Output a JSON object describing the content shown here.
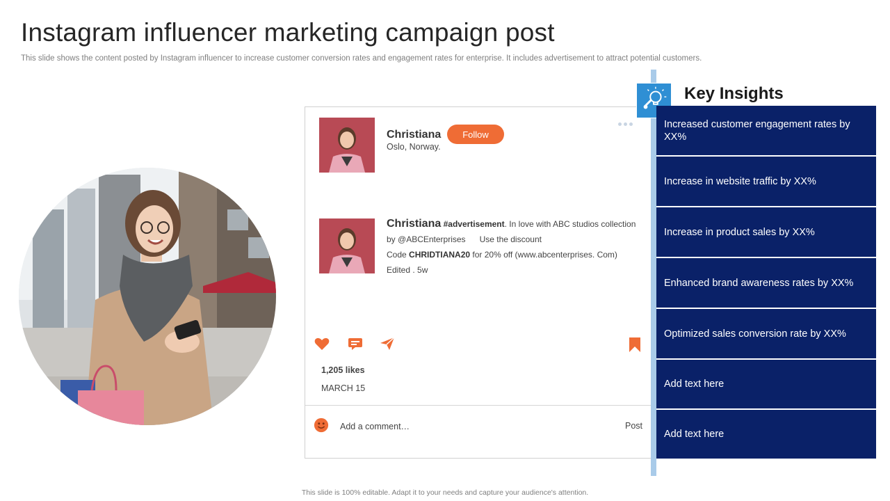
{
  "slide": {
    "title": "Instagram influencer marketing campaign post",
    "subtitle": "This slide shows the content posted by Instagram influencer to increase customer conversion rates and engagement rates for enterprise. It includes advertisement to attract potential customers.",
    "footer": "This slide is 100% editable. Adapt it to your needs and capture your audience's attention."
  },
  "post": {
    "profile": {
      "name": "Christiana",
      "location": "Oslo, Norway.",
      "follow_label": "Follow"
    },
    "caption": {
      "name": "Christiana",
      "hashtag": "#advertisement",
      "line1_rest": ". In love with ABC studios collection",
      "line2_left": "by @ABCEnterprises",
      "line2_right": "Use the discount",
      "line3_prefix": "Code",
      "code": "CHRIDTIANA20",
      "line3_suffix": "for 20% off (www.abcenterprises. Com)",
      "edited": "Edited . 5w"
    },
    "actions": {
      "like_icon": "heart-icon",
      "comment_icon": "speech-bubble-icon",
      "share_icon": "paper-plane-icon",
      "save_icon": "bookmark-icon"
    },
    "likes": "1,205 likes",
    "date": "MARCH  15",
    "comment": {
      "emoji_icon": "smiley-icon",
      "placeholder": "Add a comment…",
      "post_label": "Post"
    }
  },
  "insights": {
    "icon": "lightbulb-magnifier-icon",
    "title": "Key Insights",
    "items": [
      "Increased customer engagement rates by XX%",
      "Increase in website traffic by XX%",
      "Increase in product sales by XX%",
      "Enhanced brand awareness rates by XX%",
      "Optimized sales conversion rate by XX%",
      "Add text here",
      "Add text here"
    ]
  },
  "colors": {
    "accent_orange": "#ef6c35",
    "insight_navy": "#0a2168",
    "panel_bar_blue": "#a9cbe9",
    "icon_blue": "#2f8fd4"
  }
}
